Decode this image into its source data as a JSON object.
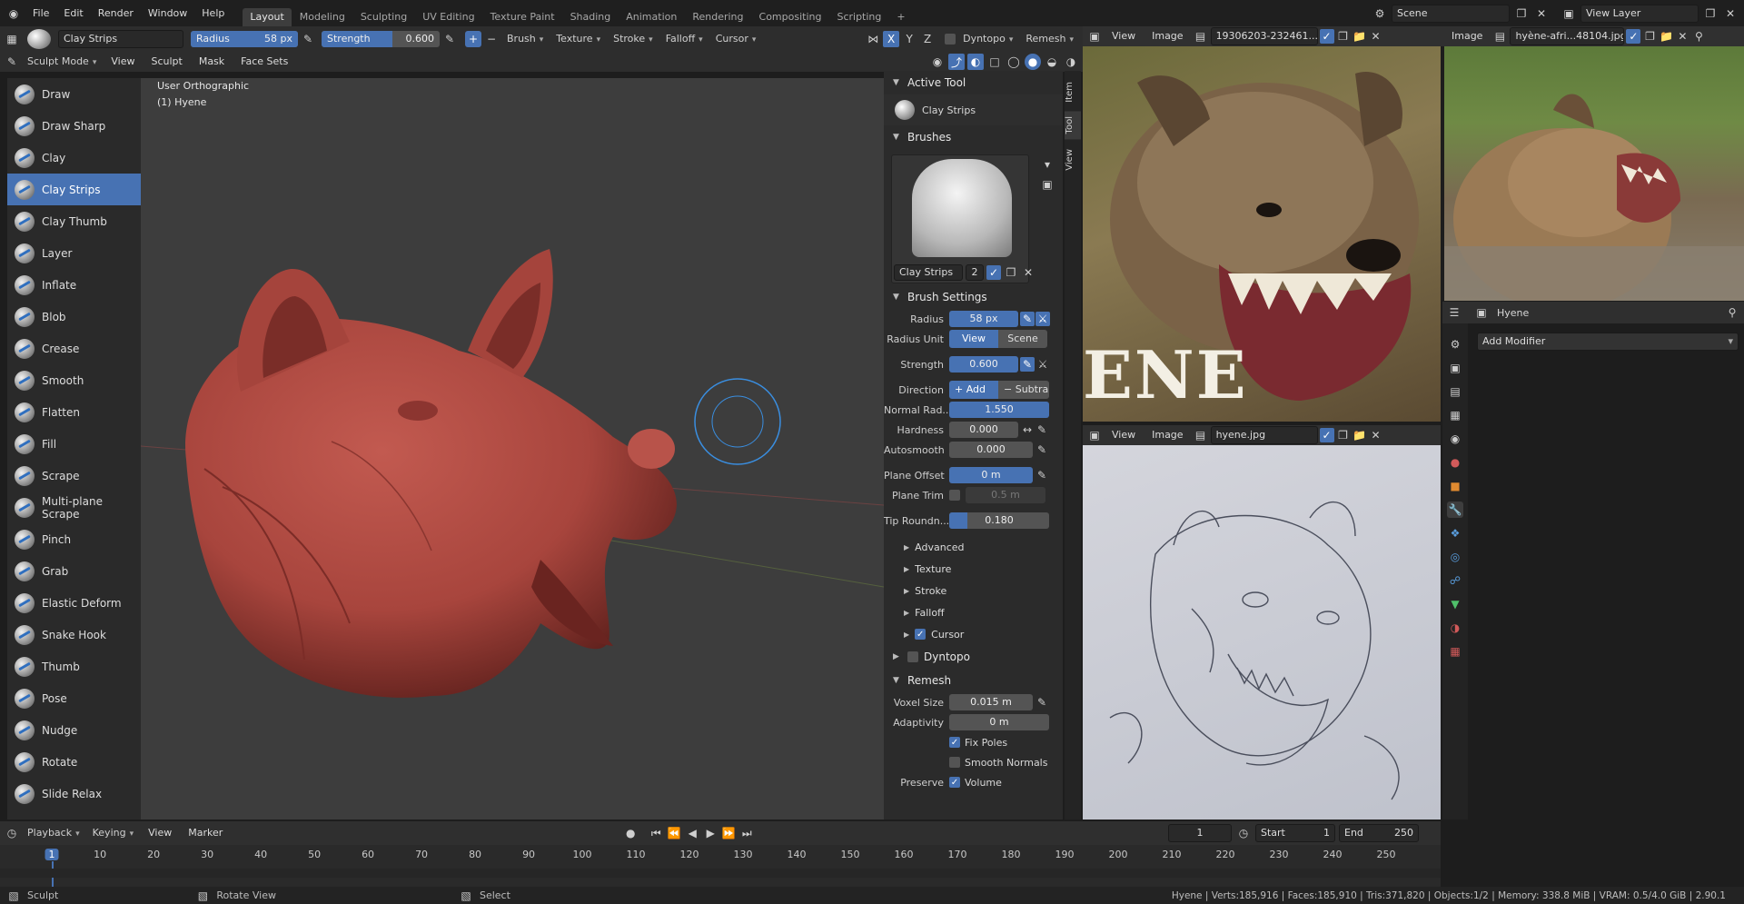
{
  "topbar": {
    "menus": [
      "File",
      "Edit",
      "Render",
      "Window",
      "Help"
    ],
    "workspaces": [
      "Layout",
      "Modeling",
      "Sculpting",
      "UV Editing",
      "Texture Paint",
      "Shading",
      "Animation",
      "Rendering",
      "Compositing",
      "Scripting"
    ],
    "active_workspace": "Layout",
    "scene": "Scene",
    "view_layer": "View Layer"
  },
  "tool_header": {
    "brush_name": "Clay Strips",
    "radius_label": "Radius",
    "radius_value": "58 px",
    "strength_label": "Strength",
    "strength_value": "0.600",
    "strength_fraction": 0.6,
    "menus": [
      "Brush",
      "Texture",
      "Stroke",
      "Falloff",
      "Cursor"
    ],
    "axes": [
      "X",
      "Y",
      "Z"
    ],
    "dyntopo": "Dyntopo",
    "remesh": "Remesh"
  },
  "viewport_header": {
    "mode": "Sculpt Mode",
    "menus": [
      "View",
      "Sculpt",
      "Mask",
      "Face Sets"
    ]
  },
  "viewport": {
    "view_name": "User Orthographic",
    "object_name": "(1) Hyene"
  },
  "tools": [
    "Draw",
    "Draw Sharp",
    "Clay",
    "Clay Strips",
    "Clay Thumb",
    "Layer",
    "Inflate",
    "Blob",
    "Crease",
    "Smooth",
    "Flatten",
    "Fill",
    "Scrape",
    "Multi-plane Scrape",
    "Pinch",
    "Grab",
    "Elastic Deform",
    "Snake Hook",
    "Thumb",
    "Pose",
    "Nudge",
    "Rotate",
    "Slide Relax"
  ],
  "active_tool_index": 3,
  "sidebar": {
    "tabs": [
      "Item",
      "Tool",
      "View"
    ],
    "active_tool_header": "Active Tool",
    "active_tool_name": "Clay Strips",
    "brushes_header": "Brushes",
    "brush_name": "Clay Strips",
    "brush_users": "2",
    "brush_settings_header": "Brush Settings",
    "radius_label": "Radius",
    "radius_value": "58 px",
    "radius_unit_label": "Radius Unit",
    "radius_unit_view": "View",
    "radius_unit_scene": "Scene",
    "strength_label": "Strength",
    "strength_value": "0.600",
    "direction_label": "Direction",
    "direction_add": "Add",
    "direction_subtract": "Subtra",
    "normal_radius_label": "Normal Rad...",
    "normal_radius_value": "1.550",
    "hardness_label": "Hardness",
    "hardness_value": "0.000",
    "autosmooth_label": "Autosmooth",
    "autosmooth_value": "0.000",
    "plane_offset_label": "Plane Offset",
    "plane_offset_value": "0 m",
    "plane_trim_label": "Plane Trim",
    "plane_trim_value": "0.5 m",
    "tip_roundness_label": "Tip Roundn...",
    "tip_roundness_value": "0.180",
    "tip_roundness_fraction": 0.18,
    "subpanels": [
      "Advanced",
      "Texture",
      "Stroke",
      "Falloff",
      "Cursor"
    ],
    "dyntopo_header": "Dyntopo",
    "remesh_header": "Remesh",
    "voxel_size_label": "Voxel Size",
    "voxel_size_value": "0.015 m",
    "adaptivity_label": "Adaptivity",
    "adaptivity_value": "0 m",
    "fix_poles": "Fix Poles",
    "smooth_normals": "Smooth Normals",
    "preserve_label": "Preserve",
    "preserve_volume": "Volume"
  },
  "image_editors": [
    {
      "menus": [
        "View",
        "Image"
      ],
      "image_name": "19306203-232461..."
    },
    {
      "menus": [
        "Image"
      ],
      "image_name": "hyène-afri...48104.jpg"
    },
    {
      "menus": [
        "View",
        "Image"
      ],
      "image_name": "hyene.jpg"
    }
  ],
  "photo_text": "ENE",
  "properties": {
    "object_name": "Hyene",
    "add_modifier": "Add Modifier"
  },
  "timeline": {
    "menus": [
      "Playback",
      "Keying",
      "View",
      "Marker"
    ],
    "current_frame": "1",
    "start_label": "Start",
    "start_value": "1",
    "end_label": "End",
    "end_value": "250",
    "ticks": [
      "1",
      "10",
      "20",
      "30",
      "40",
      "50",
      "60",
      "70",
      "80",
      "90",
      "100",
      "110",
      "120",
      "130",
      "140",
      "150",
      "160",
      "170",
      "180",
      "190",
      "200",
      "210",
      "220",
      "230",
      "240",
      "250"
    ]
  },
  "statusbar": {
    "left_action": "Sculpt",
    "middle_action": "Rotate View",
    "right_action": "Select",
    "stats": "Hyene | Verts:185,916 | Faces:185,910 | Tris:371,820 | Objects:1/2 | Memory: 338.8 MiB | VRAM: 0.5/4.0 GiB | 2.90.1"
  },
  "colors": {
    "accent": "#4772b3",
    "sculpt_clay": "#a8453d",
    "background": "#3d3d3d"
  }
}
